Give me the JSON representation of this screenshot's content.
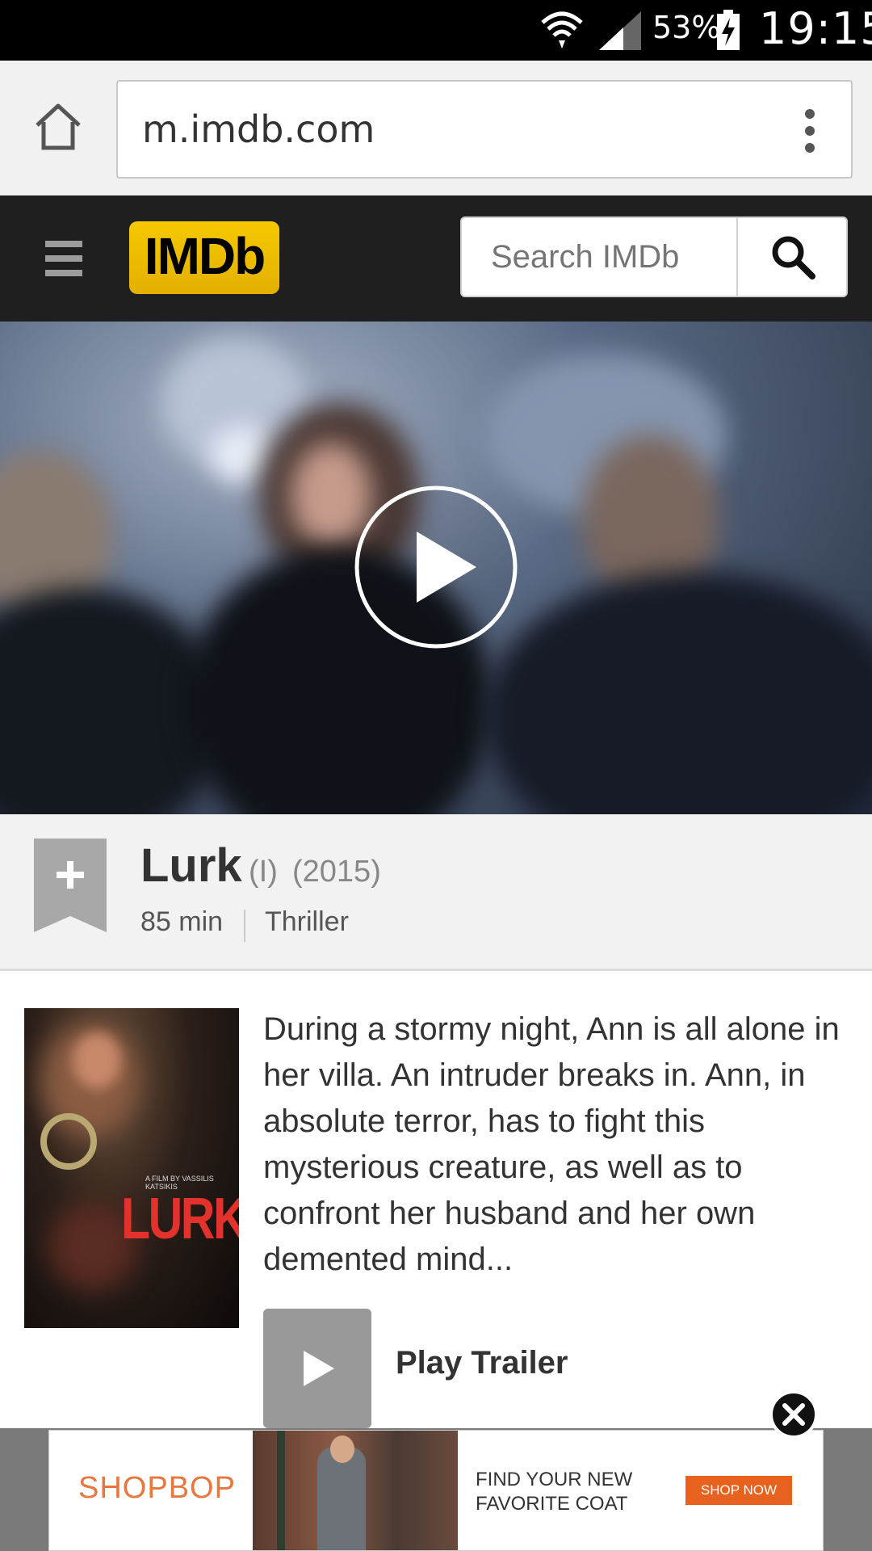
{
  "status_bar": {
    "battery_percent": "53%",
    "time": "19:15"
  },
  "browser": {
    "url": "m.imdb.com"
  },
  "imdb_header": {
    "logo": "IMDb",
    "search_placeholder": "Search IMDb"
  },
  "movie": {
    "title": "Lurk",
    "disambiguation": "(I)",
    "year": "(2015)",
    "runtime": "85 min",
    "genre": "Thriller",
    "plot": "During a stormy night, Ann is all alone in her villa. An intruder breaks in. Ann, in absolute terror, has to fight this mysterious creature, as well as to confront her husband and her own demented mind...",
    "poster": {
      "title": "LURK",
      "director": "A FILM BY VASSILIS KATSIKIS"
    }
  },
  "trailer": {
    "label": "Play Trailer"
  },
  "ad": {
    "brand": "SHOPBOP",
    "headline": "FIND YOUR NEW FAVORITE COAT",
    "cta": "SHOP NOW"
  },
  "colors": {
    "imdb_yellow": "#f5c518",
    "header_bg": "#1f1f1f",
    "ad_brand": "#e8773f",
    "ad_cta": "#e8621f",
    "poster_title": "#e3322b"
  }
}
